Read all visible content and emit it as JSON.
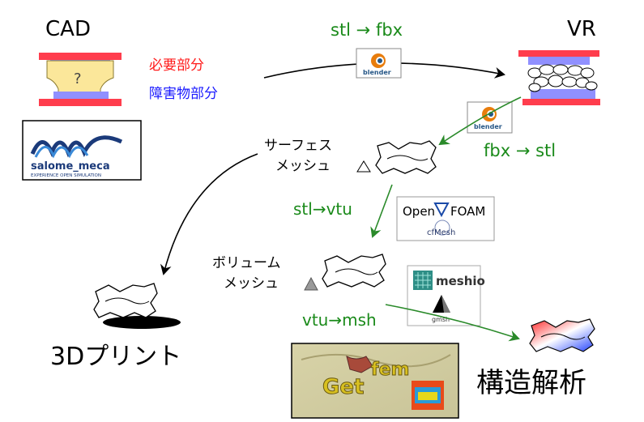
{
  "labels": {
    "cad": "CAD",
    "vr": "VR",
    "required_part": "必要部分",
    "obstacle_part": "障害物部分",
    "question_mark": "?",
    "surface_mesh_line1": "サーフェス",
    "surface_mesh_line2": "メッシュ",
    "volume_mesh_line1": "ボリューム",
    "volume_mesh_line2": "メッシュ",
    "print_3d": "3Dプリント",
    "structural_analysis": "構造解析"
  },
  "conversions": {
    "stl_to_fbx": "stl → fbx",
    "fbx_to_stl": "fbx → stl",
    "stl_to_vtu": "stl→vtu",
    "vtu_to_msh": "vtu→msh"
  },
  "logos": {
    "blender": "blender",
    "salome_name": "salome_meca",
    "salome_tagline": "EXPERIENCE OPEN SIMULATION",
    "openfoam": "Open",
    "openfoam_suffix": "FOAM",
    "cfmesh": "cfMesh",
    "meshio": "meshio",
    "gmsh": "gmsh",
    "getfem_get": "Get",
    "getfem_fem": "fem"
  },
  "colors": {
    "red_label": "#ff1a1a",
    "blue_label": "#1a1aff",
    "green_conv": "#1a8a1a",
    "plate_red": "#ff3d4d",
    "plate_blue": "#9090ff",
    "cad_fill": "#fbe79a"
  }
}
